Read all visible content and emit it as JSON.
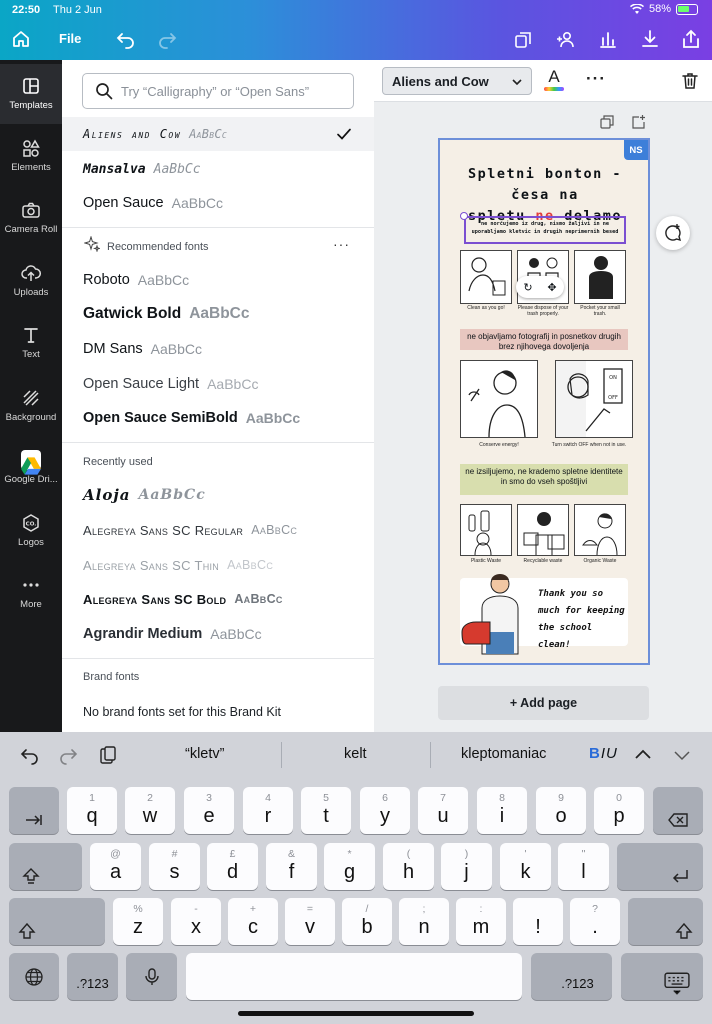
{
  "status": {
    "time": "22:50",
    "date": "Thu 2 Jun",
    "battery": "58%"
  },
  "topbar": {
    "file_label": "File"
  },
  "rail": {
    "templates": "Templates",
    "elements": "Elements",
    "camera_roll": "Camera Roll",
    "uploads": "Uploads",
    "text": "Text",
    "background": "Background",
    "google_drive": "Google Dri...",
    "logos": "Logos",
    "more": "More"
  },
  "panel": {
    "search_placeholder": "Try “Calligraphy” or “Open Sans”",
    "top_fonts": [
      {
        "name": "Aliens and Cow",
        "sample": "AaBbCc"
      },
      {
        "name": "Mansalva",
        "sample": "AaBbCc"
      },
      {
        "name": "Open Sauce",
        "sample": "AaBbCc"
      }
    ],
    "recommended_title": "Recommended fonts",
    "recommended": [
      {
        "name": "Roboto",
        "sample": "AaBbCc"
      },
      {
        "name": "Gatwick Bold",
        "sample": "AaBbCc"
      },
      {
        "name": "DM Sans",
        "sample": "AaBbCc"
      },
      {
        "name": "Open Sauce Light",
        "sample": "AaBbCc"
      },
      {
        "name": "Open Sauce SemiBold",
        "sample": "AaBbCc"
      }
    ],
    "recent_title": "Recently used",
    "recent": [
      {
        "name": "Aloja",
        "sample": "AaBbCc"
      },
      {
        "name": "Alegreya Sans SC Regular",
        "sample": "AaBbCc"
      },
      {
        "name": "Alegreya Sans SC Thin",
        "sample": "AaBbCc"
      },
      {
        "name": "Alegreya Sans SC Bold",
        "sample": "AaBbCc"
      },
      {
        "name": "Agrandir Medium",
        "sample": "AaBbCc"
      }
    ],
    "brand_title": "Brand fonts",
    "brand_empty": "No brand fonts set for this Brand Kit"
  },
  "editor": {
    "font_select": "Aliens and Cow",
    "text_color_letter": "A",
    "add_page": "+ Add page"
  },
  "design": {
    "badge": "NS",
    "title_line1": "Spletni bonton - česa na",
    "title_line2_a": "spletu ",
    "title_line2_red": "ne",
    "title_line2_b": " delamo",
    "subtitle": "ne norčujemo iz drug, nismo žaljivi in ne uporabljamo kletvic in drugih neprimernih besed",
    "row1_captions": [
      "Clean as you go!",
      "Please dispose of your trash properly.",
      "Pocket your small trash."
    ],
    "strip1": "ne objavljamo fotografij in posnetkov drugih brez njihovega dovoljenja",
    "row2_captions": [
      "Conserve energy!",
      "Turn switch OFF when not in use."
    ],
    "switch_on": "ON",
    "switch_off": "OFF",
    "strip2": "ne izsiljujemo, ne krademo spletne identitete in smo do vseh spoštljivi",
    "row3_captions": [
      "Plastic Waste",
      "Recyclable waste",
      "Organic Waste"
    ],
    "thank_you": "Thank you so much for keeping the school clean!"
  },
  "keyboard": {
    "suggestions": [
      "“kletv”",
      "kelt",
      "kleptomaniac"
    ],
    "format_b": "B",
    "format_iu": "IU",
    "row1": [
      {
        "hint": "1",
        "key": "q"
      },
      {
        "hint": "2",
        "key": "w"
      },
      {
        "hint": "3",
        "key": "e"
      },
      {
        "hint": "4",
        "key": "r"
      },
      {
        "hint": "5",
        "key": "t"
      },
      {
        "hint": "6",
        "key": "y"
      },
      {
        "hint": "7",
        "key": "u"
      },
      {
        "hint": "8",
        "key": "i"
      },
      {
        "hint": "9",
        "key": "o"
      },
      {
        "hint": "0",
        "key": "p"
      }
    ],
    "row2": [
      {
        "hint": "@",
        "key": "a"
      },
      {
        "hint": "#",
        "key": "s"
      },
      {
        "hint": "£",
        "key": "d"
      },
      {
        "hint": "&",
        "key": "f"
      },
      {
        "hint": "*",
        "key": "g"
      },
      {
        "hint": "(",
        "key": "h"
      },
      {
        "hint": ")",
        "key": "j"
      },
      {
        "hint": "'",
        "key": "k"
      },
      {
        "hint": "\"",
        "key": "l"
      }
    ],
    "row3": [
      {
        "hint": "%",
        "key": "z"
      },
      {
        "hint": "-",
        "key": "x"
      },
      {
        "hint": "+",
        "key": "c"
      },
      {
        "hint": "=",
        "key": "v"
      },
      {
        "hint": "/",
        "key": "b"
      },
      {
        "hint": ";",
        "key": "n"
      },
      {
        "hint": ":",
        "key": "m"
      },
      {
        "hint": "",
        "key": "!"
      },
      {
        "hint": "?",
        "key": "."
      }
    ],
    "num_label": ".?123"
  }
}
